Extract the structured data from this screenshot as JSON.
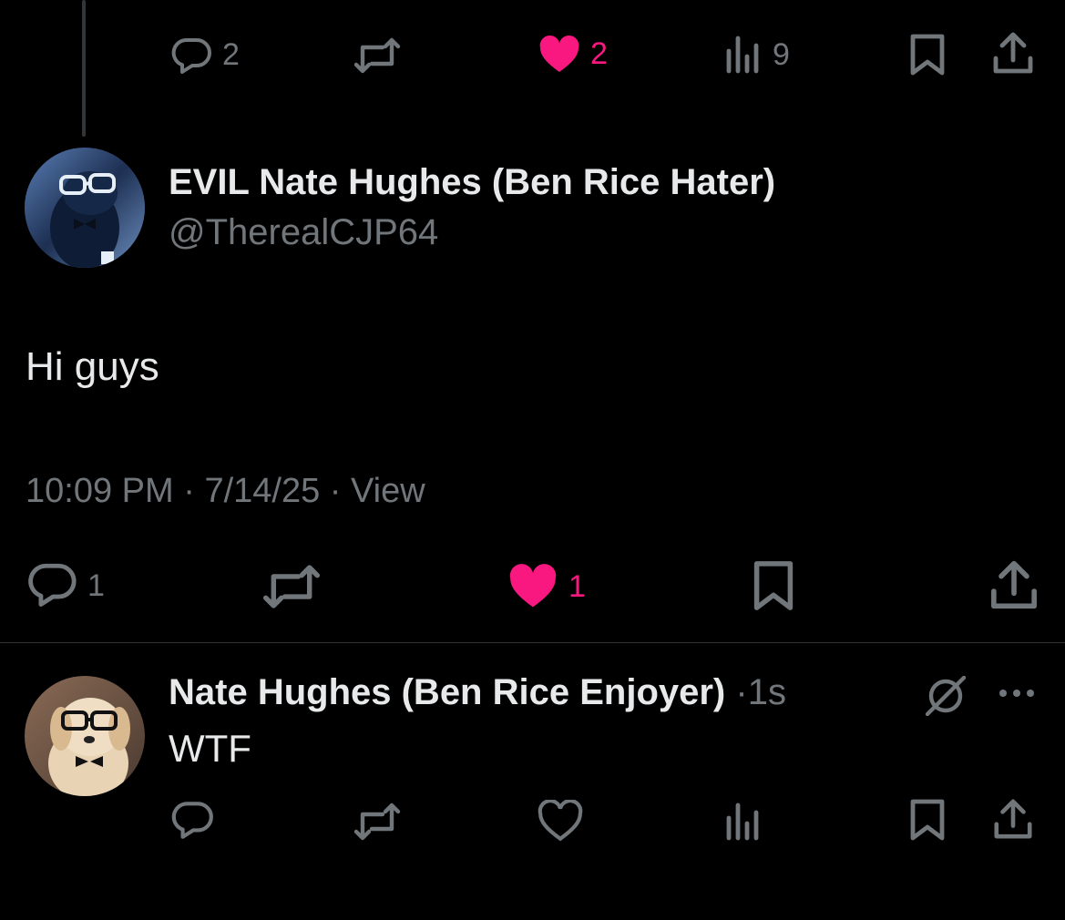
{
  "parent_tweet": {
    "stats": {
      "replies": "2",
      "likes": "2",
      "views": "9"
    }
  },
  "main_tweet": {
    "display_name": "EVIL Nate Hughes (Ben Rice Hater)",
    "handle": "@TherealCJP64",
    "text": "Hi guys",
    "time": "10:09 PM",
    "date": "7/14/25",
    "view_label": "View",
    "dot": "·",
    "stats": {
      "replies": "1",
      "likes": "1"
    }
  },
  "reply_tweet": {
    "display_name": "Nate Hughes (Ben Rice Enjoyer)",
    "dot": "·",
    "age": "1s",
    "text": "WTF"
  },
  "colors": {
    "background": "#000000",
    "text": "#e7e9ea",
    "muted": "#71767b",
    "like": "#f91880",
    "divider": "#2f3336"
  },
  "icons": [
    "reply-icon",
    "retweet-icon",
    "like-icon",
    "views-icon",
    "bookmark-icon",
    "share-icon",
    "grok-icon",
    "more-icon"
  ]
}
